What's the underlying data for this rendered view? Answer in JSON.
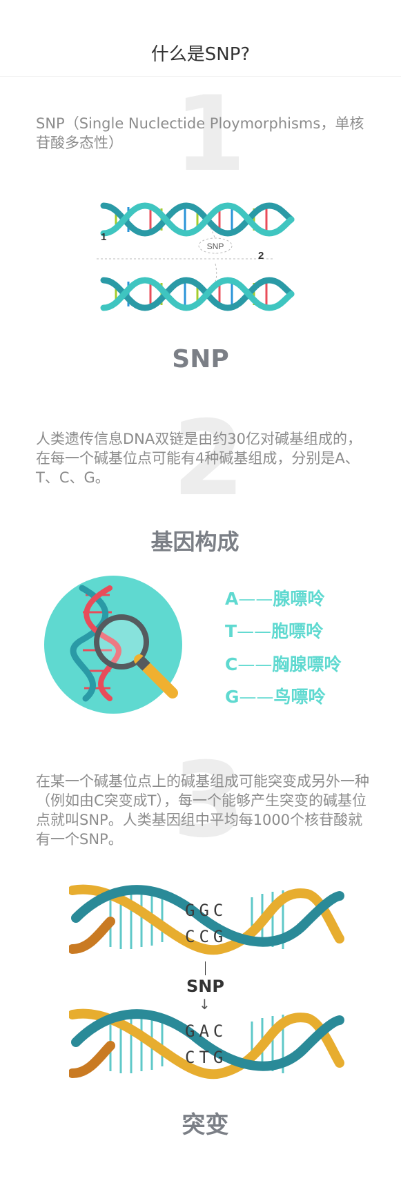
{
  "header": {
    "title": "什么是SNP?"
  },
  "section1": {
    "number": "1",
    "text": "SNP（Single Nuclectide Ploymorphisms，单核苷酸多态性）",
    "diagram": {
      "label_1": "1",
      "label_2": "2",
      "snp_tag": "SNP"
    },
    "caption": "SNP"
  },
  "section2": {
    "number": "2",
    "text": "人类遗传信息DNA双链是由约30亿对碱基组成的，在每一个碱基位点可能有4种碱基组成，分别是A、T、C、G。",
    "heading": "基因构成",
    "bases": [
      {
        "letter": "A",
        "dash": "——",
        "name": "腺嘌呤"
      },
      {
        "letter": "T",
        "dash": "——",
        "name": "胞嘌呤"
      },
      {
        "letter": "C",
        "dash": "——",
        "name": "胸腺嘌呤"
      },
      {
        "letter": "G",
        "dash": "——",
        "name": "鸟嘌呤"
      }
    ]
  },
  "section3": {
    "number": "3",
    "text": "在某一个碱基位点上的碱基组成可能突变成另外一种（例如由C突变成T），每一个能够产生突变的碱基位点就叫SNP。人类基因组中平均每1000个核苷酸就有一个SNP。",
    "seq_before_top": "GGC",
    "seq_before_bottom": "CCG",
    "arrow_label": "SNP",
    "seq_after_top": "GAC",
    "seq_after_bottom": "CTG",
    "caption": "突变"
  },
  "colors": {
    "teal": "#2a9aa6",
    "light_teal": "#5fd9d0",
    "orange": "#f0b030",
    "red": "#e84c5a",
    "green": "#a4cc2c",
    "blue": "#2a94d8"
  }
}
